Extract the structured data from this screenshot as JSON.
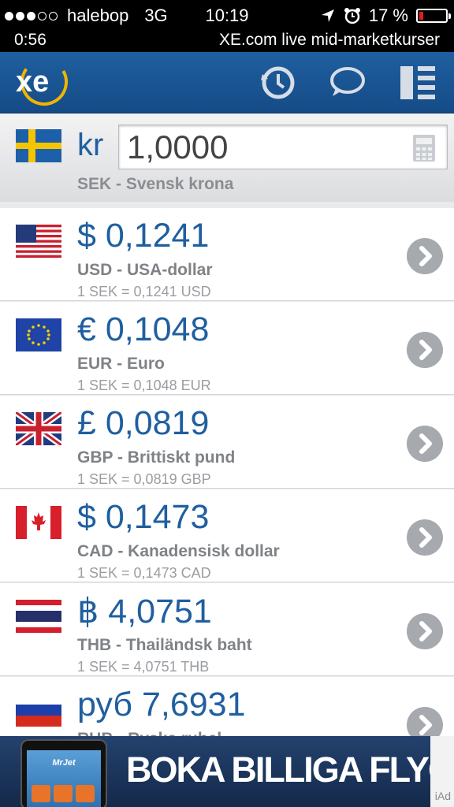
{
  "status_bar": {
    "carrier": "halebop",
    "network": "3G",
    "time": "10:19",
    "battery": "17 %",
    "battery_level": 0.17,
    "battery_color": "#e21b1b",
    "icons": [
      "location-arrow-icon",
      "alarm-icon"
    ]
  },
  "live_bar": {
    "timer": "0:56",
    "message": "XE.com live mid-marketkurser"
  },
  "header": {
    "logo_text": "xe",
    "icons": [
      "history-icon",
      "chat-icon",
      "menu-icon"
    ],
    "brand_color": "#1f5f9f"
  },
  "base": {
    "flag": "sweden-flag-icon",
    "symbol": "kr",
    "amount": "1,0000",
    "description": "SEK - Svensk krona",
    "calculator_icon": "calculator-icon"
  },
  "conversions": [
    {
      "flag": "usa-flag-icon",
      "value": "$ 0,1241",
      "name": "USD - USA-dollar",
      "rate": "1 SEK = 0,1241 USD"
    },
    {
      "flag": "eu-flag-icon",
      "value": "€ 0,1048",
      "name": "EUR - Euro",
      "rate": "1 SEK = 0,1048 EUR"
    },
    {
      "flag": "uk-flag-icon",
      "value": "£ 0,0819",
      "name": "GBP - Brittiskt pund",
      "rate": "1 SEK = 0,0819 GBP"
    },
    {
      "flag": "canada-flag-icon",
      "value": "$ 0,1473",
      "name": "CAD - Kanadensisk dollar",
      "rate": "1 SEK = 0,1473 CAD"
    },
    {
      "flag": "thailand-flag-icon",
      "value": "฿ 4,0751",
      "name": "THB - Thailändsk baht",
      "rate": "1 SEK = 4,0751 THB"
    },
    {
      "flag": "russia-flag-icon",
      "value": "руб 7,6931",
      "name": "RUB - Ryska rubel",
      "rate": ""
    }
  ],
  "ad": {
    "headline": "BOKA BILLIGA FLYG",
    "app_name": "MrJet",
    "label": "iAd"
  }
}
